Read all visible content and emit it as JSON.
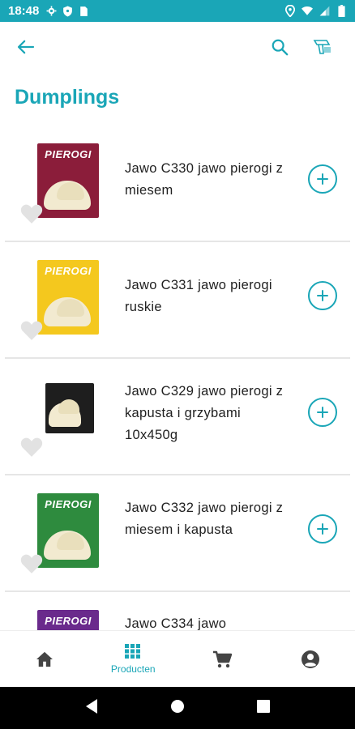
{
  "status_bar": {
    "time": "18:48",
    "left_icons": [
      "gear-icon",
      "shield-icon",
      "sim-card-icon"
    ],
    "right_icons": [
      "location-pin-icon",
      "wifi-icon",
      "signal-icon",
      "battery-icon"
    ]
  },
  "app_bar": {
    "back_icon": "arrow-left-icon",
    "search_icon": "search-icon",
    "scanner_icon": "barcode-scanner-icon"
  },
  "page": {
    "title": "Dumplings"
  },
  "products": [
    {
      "name": "Jawo C330 jawo pierogi z miesem",
      "brand": "PIEROGI",
      "pack_color": "#8b1d3a"
    },
    {
      "name": "Jawo C331 jawo pierogi ruskie",
      "brand": "PIEROGI",
      "pack_color": "#f4c81e"
    },
    {
      "name": "Jawo C329 jawo pierogi z kapusta i grzybami 10x450g",
      "brand": "",
      "pack_color": "#1e1e1e"
    },
    {
      "name": "Jawo C332 jawo pierogi z miesem i kapusta",
      "brand": "PIEROGI",
      "pack_color": "#2e8b3e"
    },
    {
      "name": "Jawo C334 jawo",
      "brand": "PIEROGI",
      "pack_color": "#6a2a8c"
    }
  ],
  "bottom_nav": {
    "items": [
      {
        "icon": "home-icon",
        "label": ""
      },
      {
        "icon": "grid-icon",
        "label": "Producten"
      },
      {
        "icon": "cart-icon",
        "label": ""
      },
      {
        "icon": "account-icon",
        "label": ""
      }
    ]
  },
  "colors": {
    "accent": "#1aa6b7",
    "text": "#212121",
    "divider": "#e6e6e6"
  }
}
